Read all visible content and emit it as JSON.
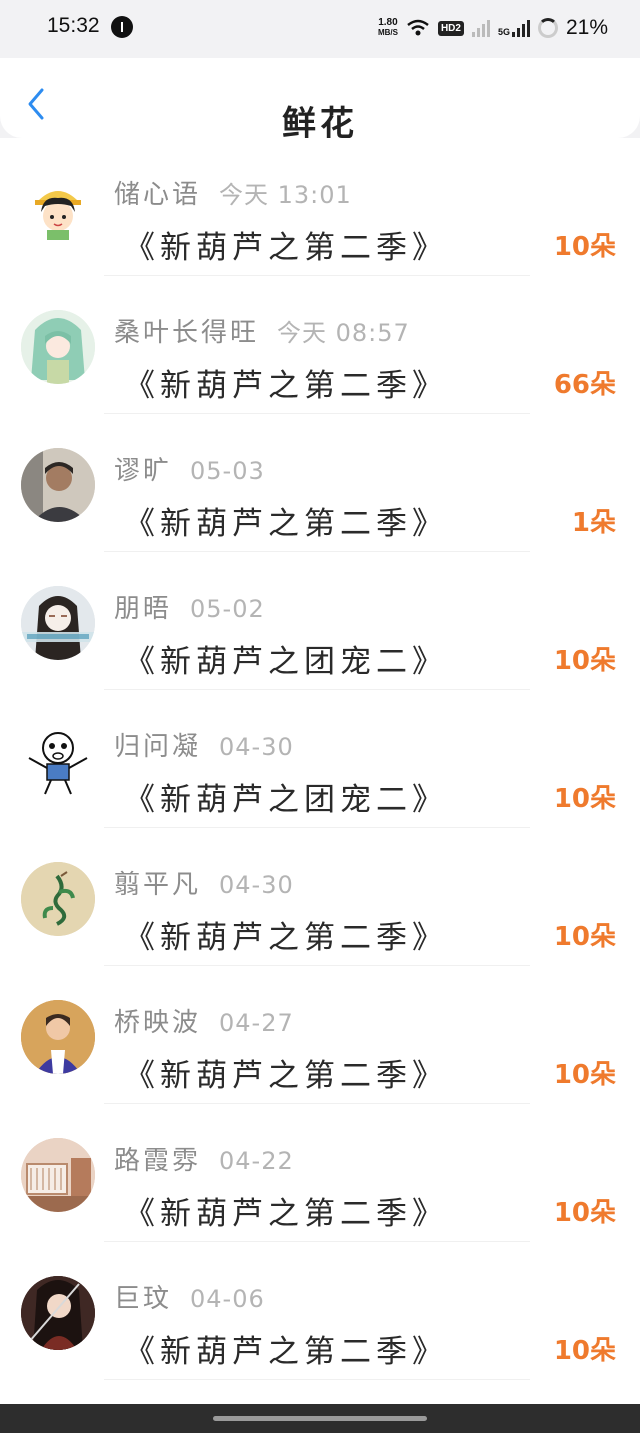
{
  "status": {
    "time": "15:32",
    "net_speed_value": "1.80",
    "net_speed_unit": "MB/S",
    "hd_label": "HD2",
    "net_type": "5G",
    "battery": "21%"
  },
  "header": {
    "title": "鲜花"
  },
  "items": [
    {
      "name": "储心语",
      "time": "今天 13:01",
      "work": "《新葫芦之第二季》",
      "count": "10朵",
      "avatar_color": "#f3c94a"
    },
    {
      "name": "桑叶长得旺",
      "time": "今天 08:57",
      "work": "《新葫芦之第二季》",
      "count": "66朵",
      "avatar_color": "#9cc9a8"
    },
    {
      "name": "谬旷",
      "time": "05-03",
      "work": "《新葫芦之第二季》",
      "count": "1朵",
      "avatar_color": "#5e5c5a"
    },
    {
      "name": "朋晤",
      "time": "05-02",
      "work": "《新葫芦之团宠二》",
      "count": "10朵",
      "avatar_color": "#d9e4ea"
    },
    {
      "name": "归问凝",
      "time": "04-30",
      "work": "《新葫芦之团宠二》",
      "count": "10朵",
      "avatar_color": "#ffffff"
    },
    {
      "name": "翦平凡",
      "time": "04-30",
      "work": "《新葫芦之第二季》",
      "count": "10朵",
      "avatar_color": "#dcc89c"
    },
    {
      "name": "桥映波",
      "time": "04-27",
      "work": "《新葫芦之第二季》",
      "count": "10朵",
      "avatar_color": "#c08a4a"
    },
    {
      "name": "路霞雰",
      "time": "04-22",
      "work": "《新葫芦之第二季》",
      "count": "10朵",
      "avatar_color": "#d8b7a4"
    },
    {
      "name": "巨玟",
      "time": "04-06",
      "work": "《新葫芦之第二季》",
      "count": "10朵",
      "avatar_color": "#4a2d28"
    }
  ],
  "colors": {
    "accent_back": "#2d8cf0",
    "flower_count": "#ef7a2d"
  }
}
